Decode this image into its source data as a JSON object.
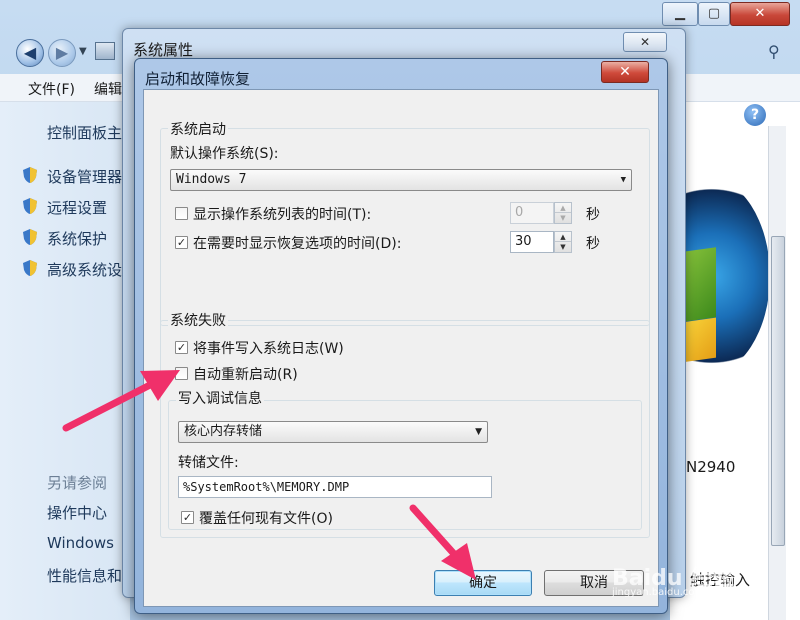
{
  "background_window": {
    "menu": [
      "文件(F)",
      "编辑"
    ],
    "sidebar": {
      "home": "控制面板主",
      "links": [
        "设备管理器",
        "远程设置",
        "系统保护",
        "高级系统设"
      ],
      "see_also_title": "另请参阅",
      "see_also": [
        "操作中心",
        "Windows",
        "性能信息和"
      ]
    },
    "partial_text_1": "N2940",
    "partial_text_2": "触控输入"
  },
  "system_properties": {
    "title": "系统属性"
  },
  "dialog": {
    "title": "启动和故障恢复",
    "close_label": "✕",
    "startup": {
      "group_label": "系统启动",
      "default_os_label": "默认操作系统(S):",
      "default_os_value": "Windows 7",
      "show_os_list": {
        "label": "显示操作系统列表的时间(T):",
        "checked": false,
        "value": "0",
        "unit": "秒"
      },
      "show_recovery": {
        "label": "在需要时显示恢复选项的时间(D):",
        "checked": true,
        "value": "30",
        "unit": "秒"
      }
    },
    "failure": {
      "group_label": "系统失败",
      "write_event": {
        "label": "将事件写入系统日志(W)",
        "checked": true
      },
      "auto_restart": {
        "label": "自动重新启动(R)",
        "checked": false
      },
      "debug": {
        "group_label": "写入调试信息",
        "type_value": "核心内存转储",
        "dump_file_label": "转储文件:",
        "dump_file_value": "%SystemRoot%\\MEMORY.DMP",
        "overwrite": {
          "label": "覆盖任何现有文件(O)",
          "checked": true
        }
      }
    },
    "ok_label": "确定",
    "cancel_label": "取消"
  },
  "watermark": {
    "text": "Baidu 经验",
    "url": "jingyan.baidu.com"
  },
  "colors": {
    "annotation_arrow": "#f0306a",
    "dialog_frame": "#93b4dc",
    "default_button": "#a7d9f5"
  }
}
